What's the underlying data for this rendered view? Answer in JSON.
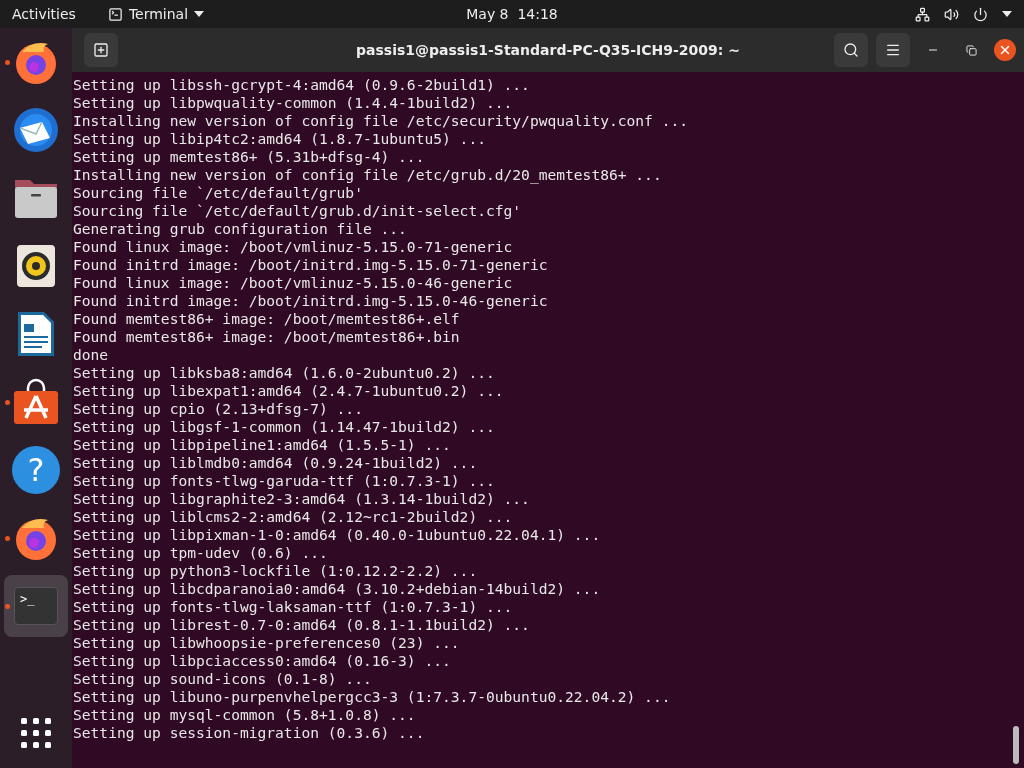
{
  "top_bar": {
    "activities": "Activities",
    "app_menu": "Terminal",
    "clock": "May 8  14:18"
  },
  "dock": {
    "items": [
      {
        "kind": "firefox",
        "running": true,
        "selected": false
      },
      {
        "kind": "thunderbird",
        "running": false,
        "selected": false
      },
      {
        "kind": "files",
        "running": false,
        "selected": false
      },
      {
        "kind": "rhythmbox",
        "running": false,
        "selected": false
      },
      {
        "kind": "writer",
        "running": false,
        "selected": false
      },
      {
        "kind": "software",
        "running": true,
        "selected": false
      },
      {
        "kind": "help",
        "glyph": "?",
        "running": false,
        "selected": false
      },
      {
        "kind": "firefox",
        "running": true,
        "selected": false
      },
      {
        "kind": "terminal",
        "glyph": ">_",
        "running": true,
        "selected": true
      }
    ]
  },
  "window": {
    "title": "passis1@passis1-Standard-PC-Q35-ICH9-2009: ~"
  },
  "terminal": {
    "lines": [
      "Setting up libssh-gcrypt-4:amd64 (0.9.6-2build1) ...",
      "Setting up libpwquality-common (1.4.4-1build2) ...",
      "Installing new version of config file /etc/security/pwquality.conf ...",
      "Setting up libip4tc2:amd64 (1.8.7-1ubuntu5) ...",
      "Setting up memtest86+ (5.31b+dfsg-4) ...",
      "Installing new version of config file /etc/grub.d/20_memtest86+ ...",
      "Sourcing file `/etc/default/grub'",
      "Sourcing file `/etc/default/grub.d/init-select.cfg'",
      "Generating grub configuration file ...",
      "Found linux image: /boot/vmlinuz-5.15.0-71-generic",
      "Found initrd image: /boot/initrd.img-5.15.0-71-generic",
      "Found linux image: /boot/vmlinuz-5.15.0-46-generic",
      "Found initrd image: /boot/initrd.img-5.15.0-46-generic",
      "Found memtest86+ image: /boot/memtest86+.elf",
      "Found memtest86+ image: /boot/memtest86+.bin",
      "done",
      "Setting up libksba8:amd64 (1.6.0-2ubuntu0.2) ...",
      "Setting up libexpat1:amd64 (2.4.7-1ubuntu0.2) ...",
      "Setting up cpio (2.13+dfsg-7) ...",
      "Setting up libgsf-1-common (1.14.47-1build2) ...",
      "Setting up libpipeline1:amd64 (1.5.5-1) ...",
      "Setting up liblmdb0:amd64 (0.9.24-1build2) ...",
      "Setting up fonts-tlwg-garuda-ttf (1:0.7.3-1) ...",
      "Setting up libgraphite2-3:amd64 (1.3.14-1build2) ...",
      "Setting up liblcms2-2:amd64 (2.12~rc1-2build2) ...",
      "Setting up libpixman-1-0:amd64 (0.40.0-1ubuntu0.22.04.1) ...",
      "Setting up tpm-udev (0.6) ...",
      "Setting up python3-lockfile (1:0.12.2-2.2) ...",
      "Setting up libcdparanoia0:amd64 (3.10.2+debian-14build2) ...",
      "Setting up fonts-tlwg-laksaman-ttf (1:0.7.3-1) ...",
      "Setting up librest-0.7-0:amd64 (0.8.1-1.1build2) ...",
      "Setting up libwhoopsie-preferences0 (23) ...",
      "Setting up libpciaccess0:amd64 (0.16-3) ...",
      "Setting up sound-icons (0.1-8) ...",
      "Setting up libuno-purpenvhelpergcc3-3 (1:7.3.7-0ubuntu0.22.04.2) ...",
      "Setting up mysql-common (5.8+1.0.8) ...",
      "Setting up session-migration (0.3.6) ..."
    ]
  }
}
